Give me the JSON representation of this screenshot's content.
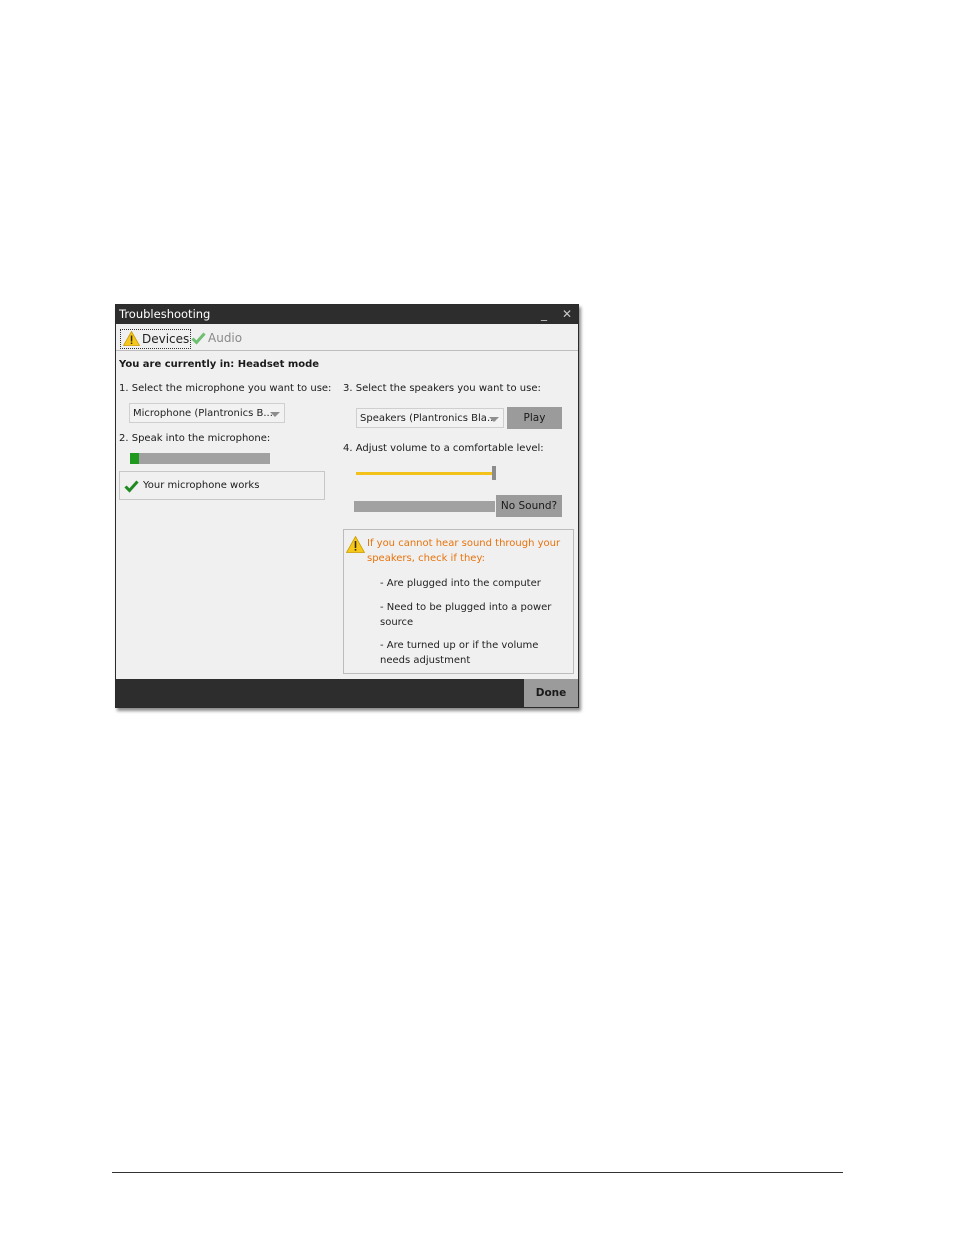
{
  "window": {
    "title": "Troubleshooting",
    "minimize_glyph": "_",
    "close_glyph": "✕"
  },
  "tabs": [
    {
      "label": "Devices",
      "icon": "warning-icon",
      "active": true
    },
    {
      "label": "Audio",
      "icon": "check-icon",
      "active": false
    }
  ],
  "status_text": "You are currently in: Headset mode",
  "microphone": {
    "step1_label": "1. Select the microphone you want to use:",
    "selected": "Microphone (Plantronics B...",
    "step2_label": "2. Speak into the microphone:",
    "level_fraction": 0.06,
    "works_text": "Your microphone works"
  },
  "speakers": {
    "step3_label": "3. Select the speakers you want to use:",
    "selected": "Speakers (Plantronics Bla...",
    "play_label": "Play",
    "step4_label": "4. Adjust volume to a comfortable level:",
    "volume_fraction": 1.0,
    "no_sound_label": "No Sound?"
  },
  "warning": {
    "heading": "If you cannot hear sound through your speakers, check if they:",
    "items": [
      "- Are plugged into the computer",
      "- Need to be plugged into a power source",
      "- Are turned up or if the volume needs adjustment"
    ]
  },
  "footer": {
    "done_label": "Done"
  },
  "colors": {
    "titlebar": "#2d2d2d",
    "warning_text": "#e8730c",
    "check_green": "#1f8a1f",
    "slider_yellow": "#f2c21b",
    "meter_green": "#1f9a1f"
  }
}
